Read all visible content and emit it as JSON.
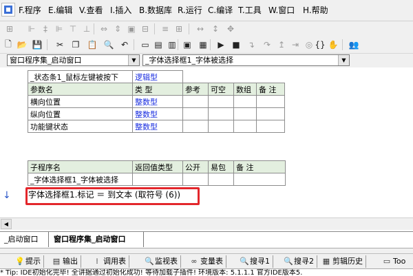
{
  "menu": {
    "items": [
      "F.程序",
      "E.编辑",
      "V.查看",
      "I.插入",
      "B.数据库",
      "R.运行",
      "C.编译",
      "T.工具",
      "W.窗口",
      "H.帮助"
    ]
  },
  "combos": {
    "left": "窗口程序集_启动窗口",
    "right": "_字体选择框1_字体被选择"
  },
  "table1": {
    "title_row": [
      "_状态条1_鼠标左键被按下",
      "逻辑型"
    ],
    "header": [
      "参数名",
      "类 型",
      "参考",
      "可空",
      "数组",
      "备 注"
    ],
    "rows": [
      [
        "横向位置",
        "整数型"
      ],
      [
        "纵向位置",
        "整数型"
      ],
      [
        "功能键状态",
        "整数型"
      ]
    ]
  },
  "table2": {
    "header": [
      "子程序名",
      "返回值类型",
      "公开",
      "易包",
      "备 注"
    ],
    "rows": [
      [
        "_字体选择框1_字体被选择"
      ]
    ]
  },
  "code": {
    "line": "字体选择框1.标记 ＝ 到文本 (取符号 (6))"
  },
  "doc_tabs": [
    "_启动窗口",
    "窗口程序集_启动窗口"
  ],
  "bottom_tabs": [
    "提示",
    "输出",
    "调用表",
    "监视表",
    "变量表",
    "搜寻1",
    "搜寻2",
    "剪辑历史",
    "Too"
  ],
  "output_text": "* Tip: IDE初始化完毕! 全讲据通过初始化成功! 等待加载子插件! 环境版本: 5.1.1.1 官方IDE版本5."
}
